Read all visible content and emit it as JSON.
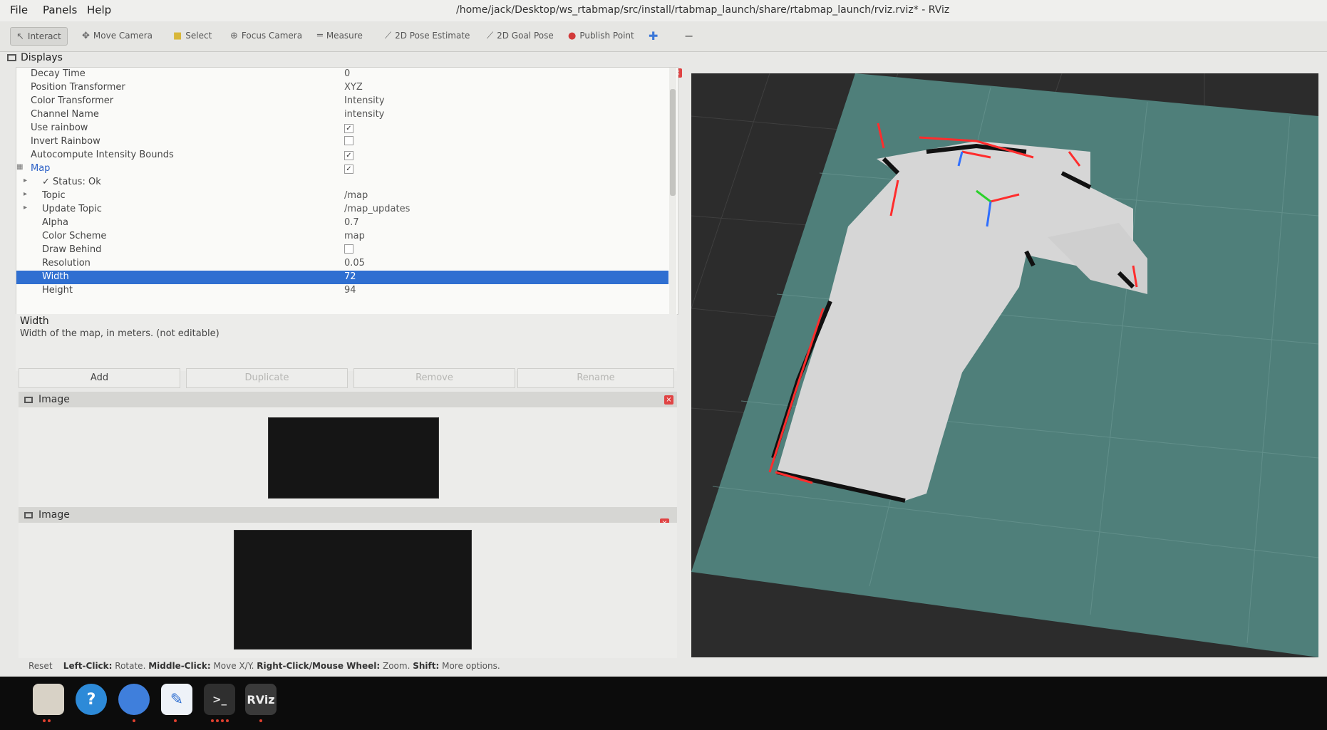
{
  "menu": [
    "File",
    "Panels",
    "Help"
  ],
  "window_title": "/home/jack/Desktop/ws_rtabmap/src/install/rtabmap_launch/share/rtabmap_launch/rviz.rviz* - RViz",
  "toolbar": [
    {
      "label": "Interact",
      "icon": "interact-icon"
    },
    {
      "label": "Move Camera",
      "icon": "move-camera-icon"
    },
    {
      "label": "Select",
      "icon": "select-icon"
    },
    {
      "label": "Focus Camera",
      "icon": "focus-camera-icon"
    },
    {
      "label": "Measure",
      "icon": "measure-icon"
    },
    {
      "label": "2D Pose Estimate",
      "icon": "pose-estimate-icon"
    },
    {
      "label": "2D Goal Pose",
      "icon": "goal-pose-icon"
    },
    {
      "label": "Publish Point",
      "icon": "pin-icon"
    }
  ],
  "displays": {
    "title": "Displays",
    "rows": [
      {
        "label": "Decay Time",
        "value": "0"
      },
      {
        "label": "Position Transformer",
        "value": "XYZ"
      },
      {
        "label": "Color Transformer",
        "value": "Intensity"
      },
      {
        "label": "Channel Name",
        "value": "intensity"
      },
      {
        "label": "Use rainbow",
        "value": "✓"
      },
      {
        "label": "Invert Rainbow",
        "value": ""
      },
      {
        "label": "Autocompute Intensity Bounds",
        "value": "✓"
      },
      {
        "label": "Map",
        "value": "✓"
      },
      {
        "label": "Status: Ok",
        "value": ""
      },
      {
        "label": "Topic",
        "value": "/map"
      },
      {
        "label": "Update Topic",
        "value": "/map_updates"
      },
      {
        "label": "Alpha",
        "value": "0.7"
      },
      {
        "label": "Color Scheme",
        "value": "map"
      },
      {
        "label": "Draw Behind",
        "value": ""
      },
      {
        "label": "Resolution",
        "value": "0.05"
      },
      {
        "label": "Width",
        "value": "72"
      },
      {
        "label": "Height",
        "value": "94"
      }
    ],
    "desc_title": "Width",
    "desc_text": "Width of the map, in meters. (not editable)",
    "buttons": [
      "Add",
      "Duplicate",
      "Remove",
      "Rename"
    ]
  },
  "image_panels": [
    {
      "title": "Image"
    },
    {
      "title": "Image"
    }
  ],
  "status": {
    "reset": "Reset",
    "left_click": "Left-Click:",
    "left_click_desc": "Rotate.",
    "middle_click": "Middle-Click:",
    "middle_click_desc": "Move X/Y.",
    "right_click": "Right-Click/Mouse Wheel:",
    "right_click_desc": "Zoom.",
    "shift": "Shift:",
    "shift_desc": "More options."
  },
  "taskbar": {
    "items": [
      {
        "name": "files-app-icon",
        "color": "#d8d2c6"
      },
      {
        "name": "help-app-icon",
        "color": "#2d8ad8",
        "glyph": "?"
      },
      {
        "name": "chromium-app-icon",
        "color": "#3f7fdc"
      },
      {
        "name": "text-editor-app-icon",
        "color": "#eef2f8"
      },
      {
        "name": "terminal-app-icon",
        "color": "#2f2f2f",
        "glyph": ">_"
      },
      {
        "name": "rviz-app-icon",
        "color": "#3a3a3a",
        "glyph": "RViz"
      }
    ]
  },
  "colors": {
    "selection": "#2f6fd1",
    "grid_floor": "#4f7f7a",
    "free_space": "#d6d6d6",
    "laser": "#ff2d2d"
  }
}
